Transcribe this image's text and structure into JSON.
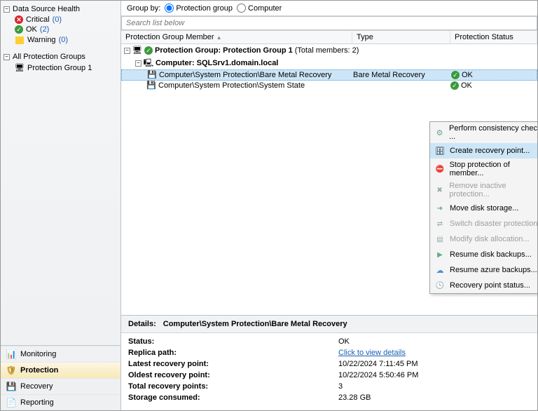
{
  "sidebar": {
    "health": {
      "title": "Data Source Health",
      "critical_label": "Critical",
      "critical_count": "(0)",
      "ok_label": "OK",
      "ok_count": "(2)",
      "warning_label": "Warning",
      "warning_count": "(0)"
    },
    "groups": {
      "title": "All Protection Groups",
      "item1": "Protection Group 1"
    },
    "nav": {
      "monitoring": "Monitoring",
      "protection": "Protection",
      "recovery": "Recovery",
      "reporting": "Reporting"
    }
  },
  "main": {
    "groupby_label": "Group by:",
    "radio_pg": "Protection group",
    "radio_computer": "Computer",
    "search_placeholder": "Search list below",
    "columns": {
      "member": "Protection Group Member",
      "type": "Type",
      "status": "Protection Status"
    },
    "pg_prefix": "Protection Group:",
    "pg_name": "Protection Group 1",
    "pg_total": "(Total members: 2)",
    "computer_prefix": "Computer:",
    "computer_name": "SQLSrv1.domain.local",
    "members": [
      {
        "path": "Computer\\System Protection\\Bare Metal Recovery",
        "type": "Bare Metal Recovery",
        "status": "OK"
      },
      {
        "path": "Computer\\System Protection\\System State",
        "type": "",
        "status": "OK"
      }
    ]
  },
  "context_menu": {
    "consistency": "Perform consistency check ...",
    "create_recovery": "Create recovery point...",
    "stop_protection": "Stop protection of member...",
    "remove_inactive": "Remove inactive protection...",
    "move_disk": "Move disk storage...",
    "switch_disaster": "Switch disaster protection",
    "modify_alloc": "Modify disk allocation...",
    "resume_disk": "Resume disk backups...",
    "resume_azure": "Resume azure backups...",
    "recovery_status": "Recovery point status..."
  },
  "details": {
    "title": "Details:",
    "subject": "Computer\\System Protection\\Bare Metal Recovery",
    "rows": {
      "status_l": "Status:",
      "status_v": "OK",
      "replica_l": "Replica path:",
      "replica_v": "Click to view details",
      "latest_l": "Latest recovery point:",
      "latest_v": "10/22/2024 7:11:45 PM",
      "oldest_l": "Oldest recovery point:",
      "oldest_v": "10/22/2024 5:50:46 PM",
      "total_l": "Total recovery points:",
      "total_v": "3",
      "storage_l": "Storage consumed:",
      "storage_v": "23.28 GB"
    }
  }
}
